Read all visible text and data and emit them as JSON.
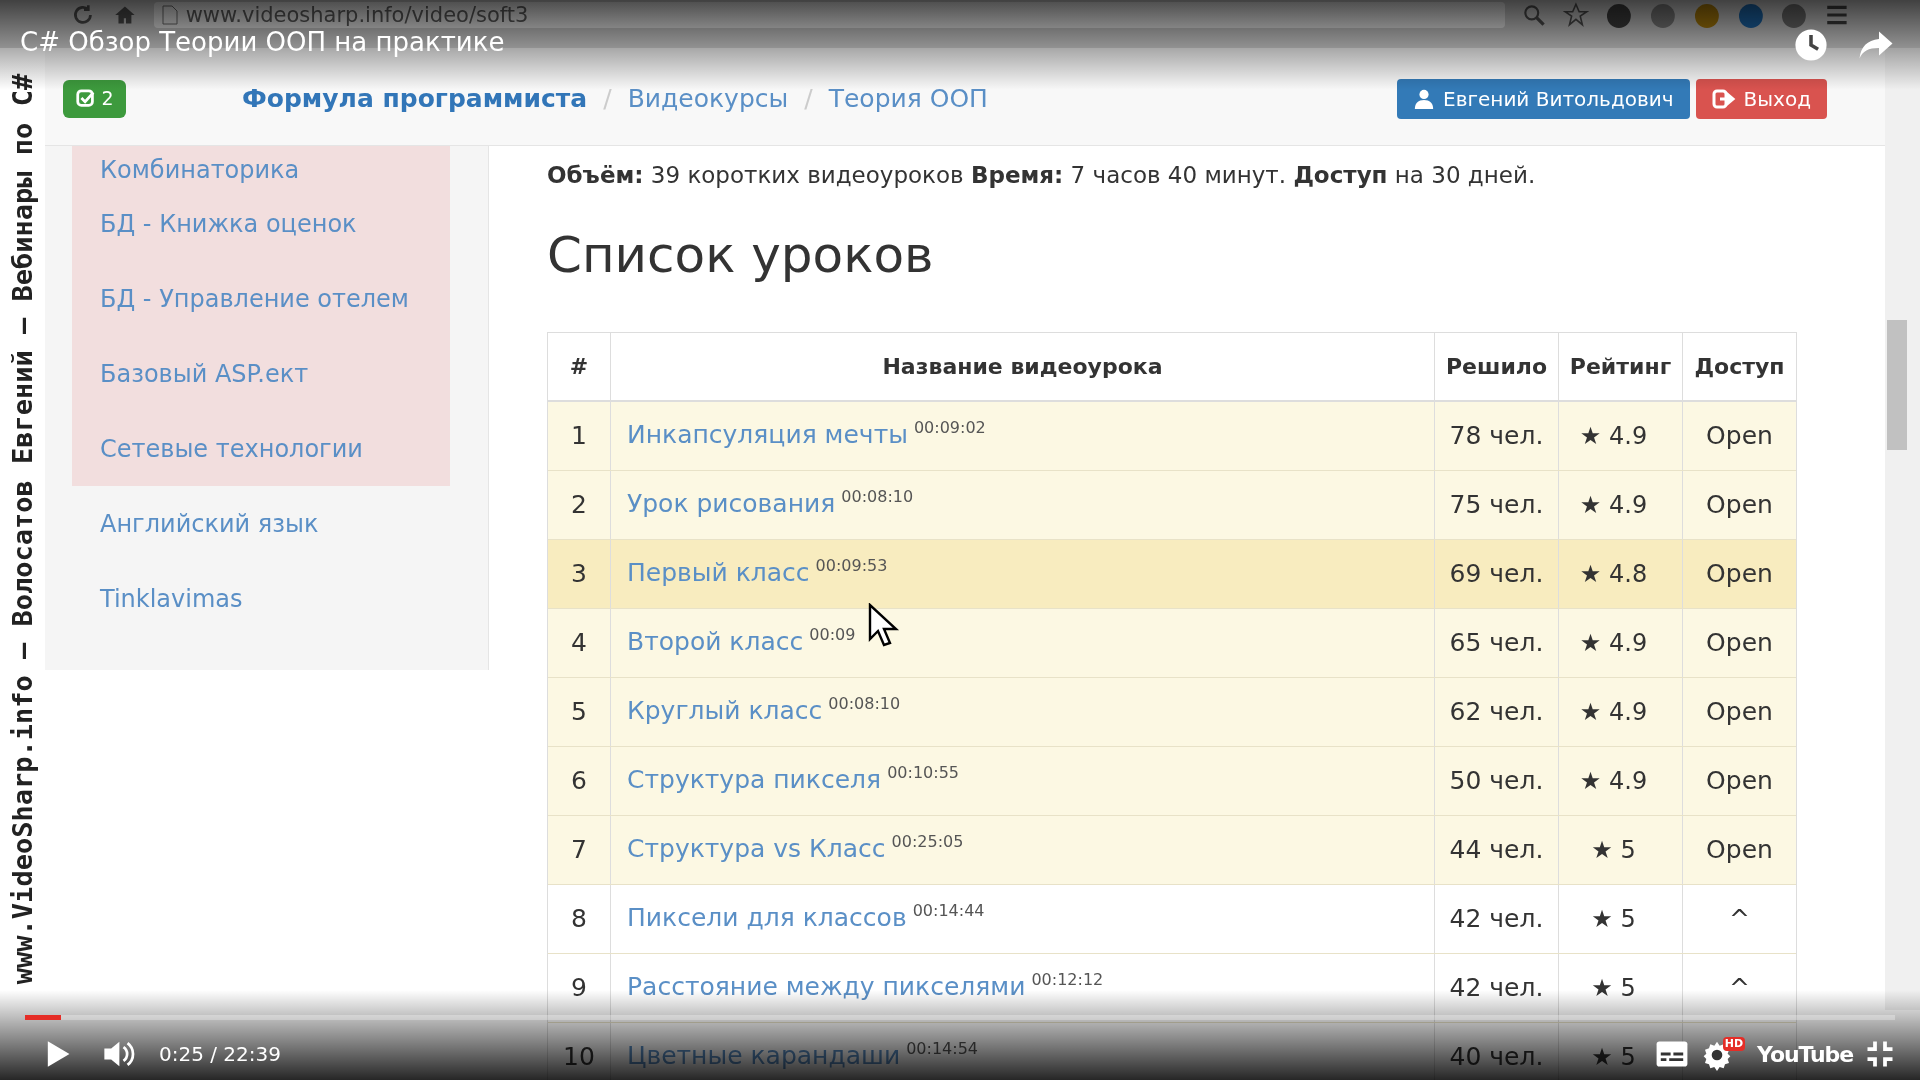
{
  "browser": {
    "url": "www.videosharp.info/video/soft3"
  },
  "video": {
    "title": "C# Обзор Теории ООП на практике",
    "watermark_side": "www.VideoSharp.info – Волосатов Евгений – Вебинары по C#"
  },
  "navbar": {
    "badge": "2",
    "separator": "/",
    "breadcrumbs": [
      {
        "label": "Формула программиста",
        "kind": "brand"
      },
      {
        "label": "Видеокурсы",
        "kind": "link"
      },
      {
        "label": "Теория ООП",
        "kind": "link"
      }
    ],
    "user_button": "Евгений Витольдович",
    "logout_button": "Выход"
  },
  "sidebar": {
    "items": [
      {
        "label": "Комбинаторика",
        "highlighted": true
      },
      {
        "label": "БД - Книжка оценок",
        "highlighted": true
      },
      {
        "label": "БД - Управление отелем",
        "highlighted": true
      },
      {
        "label": "Базовый ASP.ект",
        "highlighted": true
      },
      {
        "label": "Сетевые технологии",
        "highlighted": true
      },
      {
        "label": "Английский язык",
        "highlighted": false
      },
      {
        "label": "Tinklavimas",
        "highlighted": false
      }
    ]
  },
  "summary": "**Объём:** 39 коротких видеоуроков **Время:** 7 часов 40 минут. **Доступ** на 30 дней.",
  "heading": "Список уроков",
  "table": {
    "columns": [
      "#",
      "Название видеоурока",
      "Решило",
      "Рейтинг",
      "Доступ"
    ],
    "rows": [
      {
        "num": "1",
        "title": "Инкапсуляция мечты",
        "duration": "00:09:02",
        "solved": "78 чел.",
        "rating": "★ 4.9",
        "access": "Open",
        "highlighted": true,
        "selected": false
      },
      {
        "num": "2",
        "title": "Урок рисования",
        "duration": "00:08:10",
        "solved": "75 чел.",
        "rating": "★ 4.9",
        "access": "Open",
        "highlighted": true,
        "selected": false
      },
      {
        "num": "3",
        "title": "Первый класс",
        "duration": "00:09:53",
        "solved": "69 чел.",
        "rating": "★ 4.8",
        "access": "Open",
        "highlighted": true,
        "selected": true
      },
      {
        "num": "4",
        "title": "Второй класс",
        "duration": "00:09",
        "solved": "65 чел.",
        "rating": "★ 4.9",
        "access": "Open",
        "highlighted": true,
        "selected": false
      },
      {
        "num": "5",
        "title": "Круглый класс",
        "duration": "00:08:10",
        "solved": "62 чел.",
        "rating": "★ 4.9",
        "access": "Open",
        "highlighted": true,
        "selected": false
      },
      {
        "num": "6",
        "title": "Структура пикселя",
        "duration": "00:10:55",
        "solved": "50 чел.",
        "rating": "★ 4.9",
        "access": "Open",
        "highlighted": true,
        "selected": false
      },
      {
        "num": "7",
        "title": "Структура vs Класс",
        "duration": "00:25:05",
        "solved": "44 чел.",
        "rating": "★ 5",
        "access": "Open",
        "highlighted": true,
        "selected": false
      },
      {
        "num": "8",
        "title": "Пиксели для классов",
        "duration": "00:14:44",
        "solved": "42 чел.",
        "rating": "★ 5",
        "access": "^",
        "highlighted": false,
        "selected": false
      },
      {
        "num": "9",
        "title": "Расстояние между пикселями",
        "duration": "00:12:12",
        "solved": "42 чел.",
        "rating": "★ 5",
        "access": "^",
        "highlighted": false,
        "selected": false
      },
      {
        "num": "10",
        "title": "Цветные карандаши",
        "duration": "00:14:54",
        "solved": "40 чел.",
        "rating": "★ 5",
        "highlighted": false,
        "selected": false
      }
    ]
  },
  "player": {
    "progress": {
      "level": 0.019
    },
    "time": "0:25 / 22:39",
    "hd_badge": "HD",
    "logo": "YouTube"
  }
}
